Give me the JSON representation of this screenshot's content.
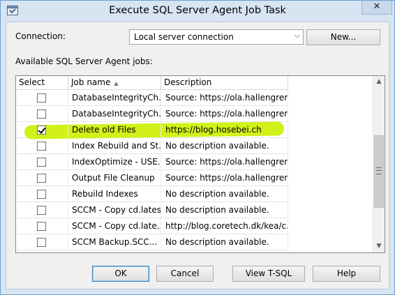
{
  "window": {
    "title": "Execute SQL Server Agent Job Task",
    "close_glyph": "✕"
  },
  "connection": {
    "label": "Connection:",
    "value": "Local server connection",
    "new_button": "New..."
  },
  "jobs_label": "Available SQL Server Agent jobs:",
  "grid": {
    "columns": {
      "select": "Select",
      "job_name": "Job name",
      "description": "Description"
    },
    "rows": [
      {
        "checked": false,
        "name": "DatabaseIntegrityCh...",
        "desc": "Source: https://ola.hallengren..."
      },
      {
        "checked": false,
        "name": "DatabaseIntegrityCh...",
        "desc": "Source: https://ola.hallengren..."
      },
      {
        "checked": true,
        "name": "Delete old Files",
        "desc": "https://blog.hosebei.ch"
      },
      {
        "checked": false,
        "name": "Index Rebuild and St...",
        "desc": "No description available."
      },
      {
        "checked": false,
        "name": "IndexOptimize - USE...",
        "desc": "Source: https://ola.hallengren..."
      },
      {
        "checked": false,
        "name": "Output File Cleanup",
        "desc": "Source: https://ola.hallengren..."
      },
      {
        "checked": false,
        "name": "Rebuild Indexes",
        "desc": "No description available."
      },
      {
        "checked": false,
        "name": "SCCM - Copy cd.latest",
        "desc": "No description available."
      },
      {
        "checked": false,
        "name": "SCCM - Copy cd.late...",
        "desc": "http://blog.coretech.dk/kea/c..."
      },
      {
        "checked": false,
        "name": "SCCM Backup.SCC...",
        "desc": "No description available."
      }
    ]
  },
  "buttons": {
    "ok": "OK",
    "cancel": "Cancel",
    "view_tsql": "View T-SQL",
    "help": "Help"
  },
  "colors": {
    "highlight": "#ccf000",
    "title_bar": "#d7e4f2"
  }
}
